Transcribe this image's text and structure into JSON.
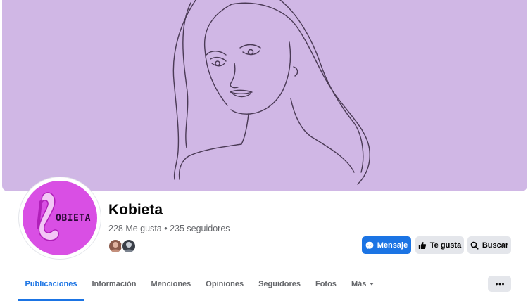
{
  "cover": {
    "background": "#d0b7e5",
    "line_color": "#4a3a55",
    "illustration": "woman-face-line-art"
  },
  "profile": {
    "avatar_color": "#d94fe4",
    "logo_letter": "K",
    "logo_text": "OBIETA",
    "name": "Kobieta",
    "stats": "228 Me gusta • 235 seguidores"
  },
  "actions": {
    "message": "Mensaje",
    "like": "Te gusta",
    "search": "Buscar"
  },
  "tabs": [
    {
      "label": "Publicaciones",
      "active": true
    },
    {
      "label": "Información",
      "active": false
    },
    {
      "label": "Menciones",
      "active": false
    },
    {
      "label": "Opiniones",
      "active": false
    },
    {
      "label": "Seguidores",
      "active": false
    },
    {
      "label": "Fotos",
      "active": false
    },
    {
      "label": "Más",
      "active": false
    }
  ],
  "colors": {
    "accent": "#1b74e4",
    "secondary_button": "#e4e6eb",
    "muted_text": "#65676b"
  }
}
